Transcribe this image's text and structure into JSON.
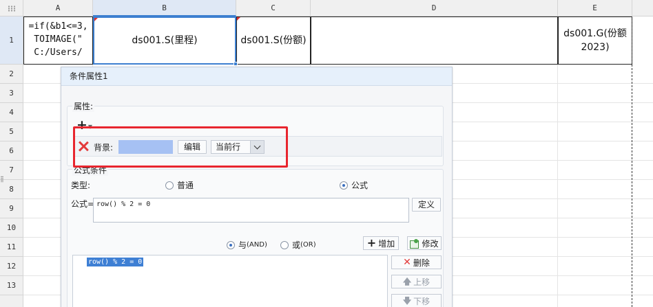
{
  "sheet": {
    "columns": [
      "A",
      "B",
      "C",
      "D",
      "E"
    ],
    "rows": [
      "1",
      "2",
      "3",
      "4",
      "5",
      "6",
      "7",
      "8",
      "9",
      "10",
      "11",
      "12",
      "13"
    ],
    "cells": {
      "A1": "=if(&b1<=3,\nTOIMAGE(\"\nC:/Users/",
      "B1": "ds001.S(里程)",
      "C1": "ds001.S(份额)",
      "D1": "",
      "E1": "ds001.G(份额2023)"
    }
  },
  "dialog": {
    "title": "条件属性1",
    "attributes": {
      "group_label": "属性:",
      "add_icon": "plus-icon",
      "row": {
        "remove_icon": "close-icon",
        "label": "背景:",
        "color": "#a6c1f3",
        "edit_label": "编辑",
        "scope_value": "当前行"
      }
    },
    "condition": {
      "group_label": "公式条件",
      "type_label": "类型:",
      "type_normal": "普通",
      "type_formula": "公式",
      "formula_label": "公式=",
      "formula_value": "row() % 2 = 0",
      "define_label": "定义",
      "and_label": "与",
      "and_suffix": "(AND)",
      "or_label": "或",
      "or_suffix": "(OR)",
      "add_label": "增加",
      "modify_label": "修改",
      "delete_label": "删除",
      "up_label": "上移",
      "down_label": "下移",
      "list_items": [
        "row() % 2 = 0"
      ]
    }
  },
  "colors": {
    "highlight": "#e8252e",
    "selection": "#3c7fd0",
    "list_selection": "#3e7fd4"
  }
}
